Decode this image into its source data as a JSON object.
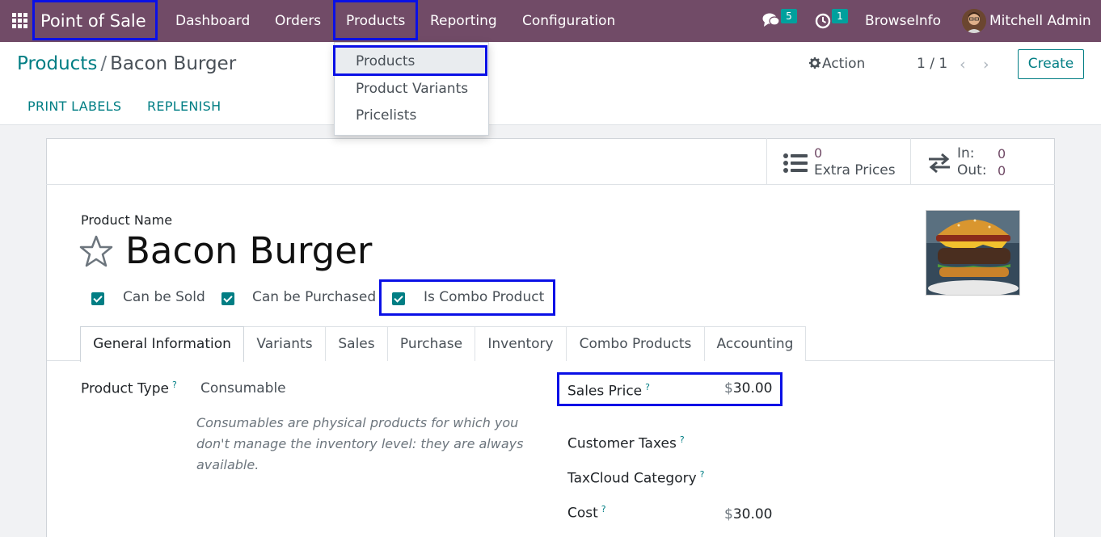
{
  "navbar": {
    "app_name": "Point of Sale",
    "menu": [
      "Dashboard",
      "Orders",
      "Products",
      "Reporting",
      "Configuration"
    ],
    "messages_count": "5",
    "activities_count": "1",
    "company": "BrowseInfo",
    "user": "Mitchell Admin"
  },
  "products_menu": {
    "items": [
      "Products",
      "Product Variants",
      "Pricelists"
    ]
  },
  "breadcrumb": {
    "parent": "Products",
    "separator": "/",
    "current": "Bacon Burger"
  },
  "control": {
    "print_labels": "PRINT LABELS",
    "replenish": "REPLENISH",
    "action": "Action",
    "pager": "1 / 1",
    "create": "Create"
  },
  "smart_buttons": {
    "extra_prices_count": "0",
    "extra_prices_label": "Extra Prices",
    "in_label": "In:",
    "in_value": "0",
    "out_label": "Out:",
    "out_value": "0"
  },
  "product": {
    "name_label": "Product Name",
    "name": "Bacon Burger",
    "options": [
      {
        "label": "Can be Sold",
        "checked": true
      },
      {
        "label": "Can be Purchased",
        "checked": true
      },
      {
        "label": "Is Combo Product",
        "checked": true
      }
    ]
  },
  "tabs": [
    "General Information",
    "Variants",
    "Sales",
    "Purchase",
    "Inventory",
    "Combo Products",
    "Accounting"
  ],
  "general": {
    "product_type_label": "Product Type",
    "product_type_value": "Consumable",
    "product_type_help": "Consumables are physical products for which you don't manage the inventory level: they are always available.",
    "sales_price_label": "Sales Price",
    "sales_price_currency": "$",
    "sales_price_value": "30.00",
    "customer_taxes_label": "Customer Taxes",
    "taxcloud_label": "TaxCloud Category",
    "cost_label": "Cost",
    "cost_currency": "$",
    "cost_value": "30.00",
    "help_mark": "?"
  },
  "colors": {
    "navbar": "#714b67",
    "accent": "#017e84",
    "highlight_box": "#0a10e6",
    "badge": "#00a09d"
  }
}
